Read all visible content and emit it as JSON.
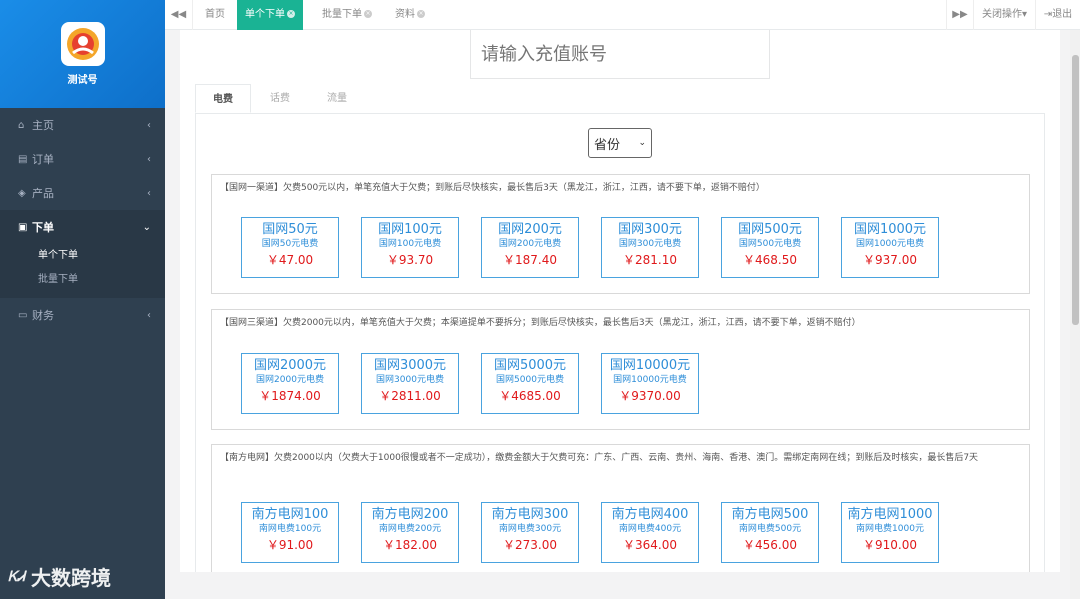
{
  "app": {
    "name": "测试号"
  },
  "sidebar": {
    "items": [
      {
        "label": "主页",
        "icon": "home-icon"
      },
      {
        "label": "订单",
        "icon": "file-icon"
      },
      {
        "label": "产品",
        "icon": "cube-icon"
      },
      {
        "label": "下单",
        "icon": "edit-icon"
      },
      {
        "label": "财务",
        "icon": "money-icon"
      }
    ],
    "sub_items": [
      {
        "label": "单个下单"
      },
      {
        "label": "批量下单"
      }
    ]
  },
  "topbar": {
    "tabs": [
      {
        "label": "首页"
      },
      {
        "label": "单个下单"
      },
      {
        "label": "批量下单"
      },
      {
        "label": "资料"
      }
    ],
    "close_ops": "关闭操作",
    "logout": "退出"
  },
  "form": {
    "account_placeholder": "请输入充值账号"
  },
  "content_tabs": [
    {
      "label": "电费"
    },
    {
      "label": "话费"
    },
    {
      "label": "流量"
    }
  ],
  "province_select": {
    "value": "省份"
  },
  "groups": [
    {
      "desc": "【国网一渠道】欠费500元以内，单笔充值大于欠费；到账后尽快核实，最长售后3天（黑龙江，浙江，江西，请不要下单，返销不赔付）",
      "items": [
        {
          "title": "国网50元",
          "sub": "国网50元电费",
          "price": "￥47.00"
        },
        {
          "title": "国网100元",
          "sub": "国网100元电费",
          "price": "￥93.70"
        },
        {
          "title": "国网200元",
          "sub": "国网200元电费",
          "price": "￥187.40"
        },
        {
          "title": "国网300元",
          "sub": "国网300元电费",
          "price": "￥281.10"
        },
        {
          "title": "国网500元",
          "sub": "国网500元电费",
          "price": "￥468.50"
        },
        {
          "title": "国网1000元",
          "sub": "国网1000元电费",
          "price": "￥937.00"
        }
      ]
    },
    {
      "desc": "【国网三渠道】欠费2000元以内，单笔充值大于欠费；本渠道提单不要拆分；到账后尽快核实，最长售后3天（黑龙江，浙江，江西，请不要下单，返销不赔付）",
      "items": [
        {
          "title": "国网2000元",
          "sub": "国网2000元电费",
          "price": "￥1874.00"
        },
        {
          "title": "国网3000元",
          "sub": "国网3000元电费",
          "price": "￥2811.00"
        },
        {
          "title": "国网5000元",
          "sub": "国网5000元电费",
          "price": "￥4685.00"
        },
        {
          "title": "国网10000元",
          "sub": "国网10000元电费",
          "price": "￥9370.00"
        }
      ]
    },
    {
      "desc": "【南方电网】欠费2000以内（欠费大于1000很慢或者不一定成功），缴费金额大于欠费可充：广东、广西、云南、贵州、海南、香港、澳门。需绑定南网在线；到账后及时核实，最长售后7天",
      "items": [
        {
          "title": "南方电网100",
          "sub": "南网电费100元",
          "price": "￥91.00"
        },
        {
          "title": "南方电网200",
          "sub": "南网电费200元",
          "price": "￥182.00"
        },
        {
          "title": "南方电网300",
          "sub": "南网电费300元",
          "price": "￥273.00"
        },
        {
          "title": "南方电网400",
          "sub": "南网电费400元",
          "price": "￥364.00"
        },
        {
          "title": "南方电网500",
          "sub": "南网电费500元",
          "price": "￥456.00"
        },
        {
          "title": "南方电网1000",
          "sub": "南网电费1000元",
          "price": "￥910.00"
        }
      ]
    }
  ],
  "watermark": {
    "text": "大数跨境"
  },
  "colors": {
    "sidebar": "#2f4050",
    "accent": "#1ab394",
    "card_border": "#4aa3df",
    "price": "#e0191b"
  }
}
